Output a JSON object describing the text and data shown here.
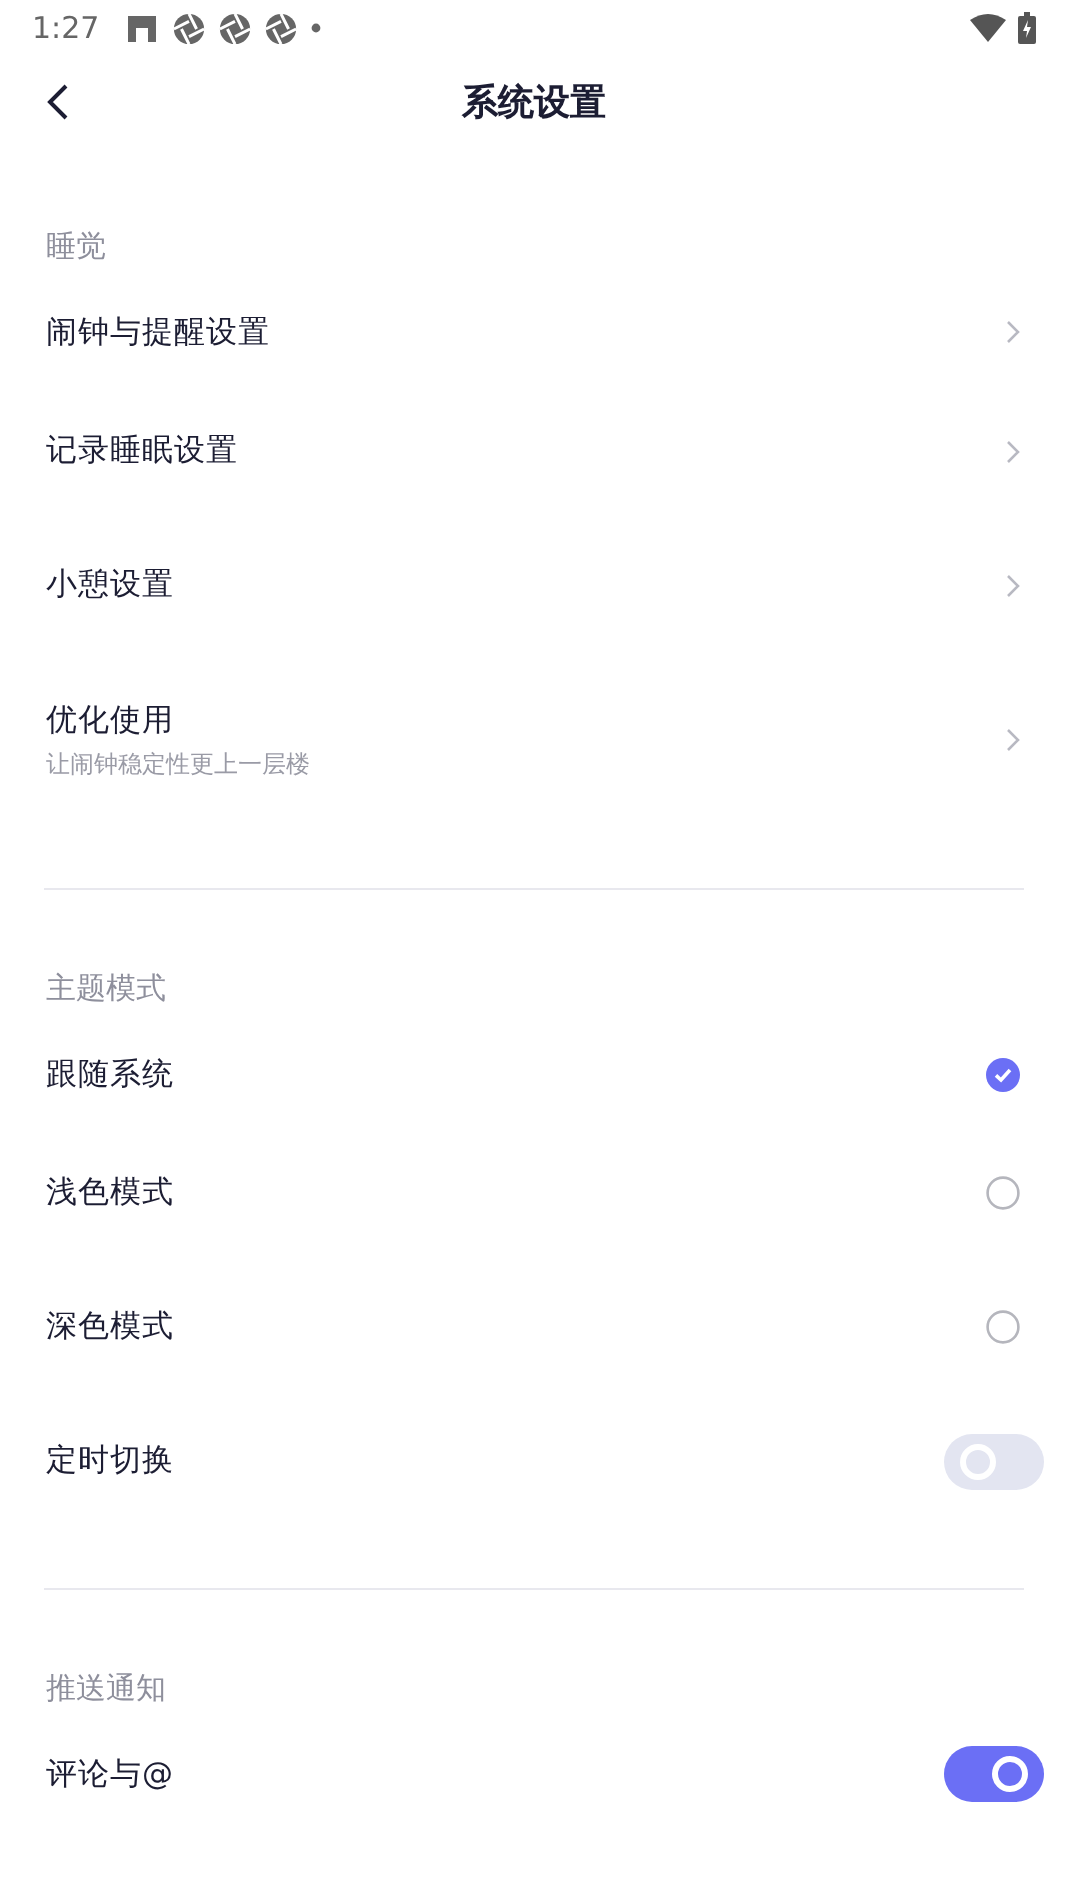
{
  "status_bar": {
    "time": "1:27"
  },
  "header": {
    "title": "系统设置"
  },
  "sections": [
    {
      "title": "睡觉",
      "items": [
        {
          "kind": "nav",
          "label": "闹钟与提醒设置"
        },
        {
          "kind": "nav",
          "label": "记录睡眠设置"
        },
        {
          "kind": "nav",
          "label": "小憩设置"
        },
        {
          "kind": "nav",
          "label": "优化使用",
          "subtitle": "让闹钟稳定性更上一层楼"
        }
      ]
    },
    {
      "title": "主题模式",
      "items": [
        {
          "kind": "radio",
          "label": "跟随系统",
          "selected": true
        },
        {
          "kind": "radio",
          "label": "浅色模式",
          "selected": false
        },
        {
          "kind": "radio",
          "label": "深色模式",
          "selected": false
        },
        {
          "kind": "toggle",
          "label": "定时切换",
          "on": false
        }
      ]
    },
    {
      "title": "推送通知",
      "items": [
        {
          "kind": "toggle",
          "label": "评论与@",
          "on": true
        }
      ]
    }
  ]
}
